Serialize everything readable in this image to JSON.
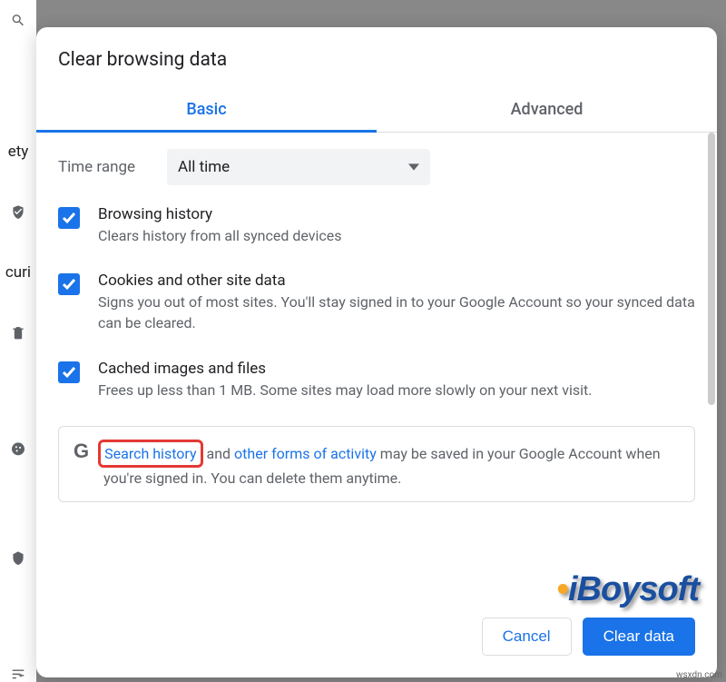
{
  "back": {
    "t1": "ety",
    "t2": "curi"
  },
  "dialog": {
    "title": "Clear browsing data",
    "tabs": {
      "basic": "Basic",
      "advanced": "Advanced"
    },
    "time": {
      "label": "Time range",
      "value": "All time"
    },
    "items": [
      {
        "title": "Browsing history",
        "desc": "Clears history from all synced devices"
      },
      {
        "title": "Cookies and other site data",
        "desc": "Signs you out of most sites. You'll stay signed in to your Google Account so your synced data can be cleared."
      },
      {
        "title": "Cached images and files",
        "desc": "Frees up less than 1 MB. Some sites may load more slowly on your next visit."
      }
    ],
    "info": {
      "search_link": "Search history",
      "mid1": " and ",
      "other_link": "other forms of activity",
      "mid2": " may be saved in your Google Account when you're signed in. You can delete them anytime."
    },
    "buttons": {
      "cancel": "Cancel",
      "clear": "Clear data"
    }
  },
  "watermark": {
    "pre": "i",
    "main": "Boysoft"
  },
  "footer_mark": "wsxdn.com"
}
